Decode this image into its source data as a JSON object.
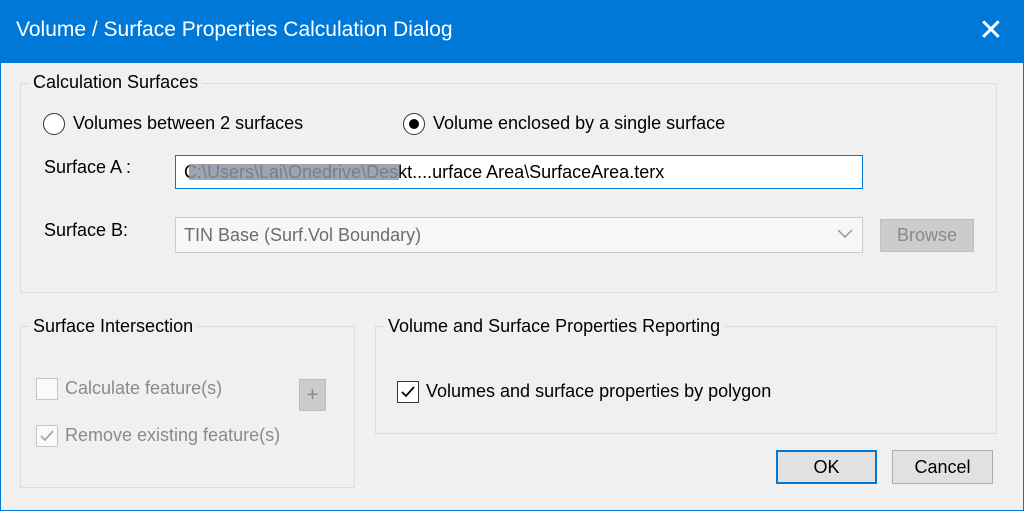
{
  "window": {
    "title": "Volume / Surface Properties Calculation Dialog",
    "close_symbol": "✕"
  },
  "calc_surfaces": {
    "label": "Calculation Surfaces",
    "radio_two_surfaces": "Volumes between 2 surfaces",
    "radio_single_surface": "Volume enclosed by a single surface",
    "selected": "single",
    "surface_a_label": "Surface A :",
    "surface_a_value": "C:\\Users\\Lai\\Onedrive\\Deskt....urface Area\\SurfaceArea.terx",
    "surface_b_label": "Surface B:",
    "surface_b_value": "TIN Base (Surf.Vol Boundary)",
    "browse_label": "Browse"
  },
  "intersection": {
    "label": "Surface Intersection",
    "calc_features_label": "Calculate feature(s)",
    "calc_features_checked": false,
    "remove_features_label": "Remove existing feature(s)",
    "remove_features_checked": true,
    "plus_label": "+"
  },
  "reporting": {
    "label": "Volume and Surface Properties Reporting",
    "by_polygon_label": "Volumes and surface properties by polygon",
    "by_polygon_checked": true
  },
  "buttons": {
    "ok": "OK",
    "cancel": "Cancel"
  }
}
